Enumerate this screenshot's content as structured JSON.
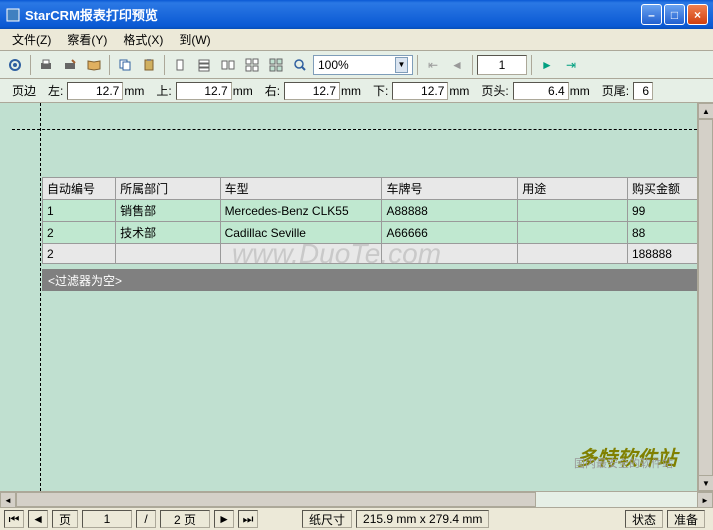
{
  "window": {
    "title": "StarCRM报表打印预览"
  },
  "menu": {
    "file": "文件(Z)",
    "view": "察看(Y)",
    "format": "格式(X)",
    "goto": "到(W)"
  },
  "toolbar": {
    "zoom": "100%",
    "page": "1"
  },
  "margins": {
    "label": "页边",
    "left_lbl": "左:",
    "left": "12.7",
    "left_u": "mm",
    "top_lbl": "上:",
    "top": "12.7",
    "top_u": "mm",
    "right_lbl": "右:",
    "right": "12.7",
    "right_u": "mm",
    "bottom_lbl": "下:",
    "bottom": "12.7",
    "bottom_u": "mm",
    "header_lbl": "页头:",
    "header": "6.4",
    "header_u": "mm",
    "footer_lbl": "页尾:",
    "footer": "6"
  },
  "table": {
    "headers": {
      "id": "自动编号",
      "dept": "所属部门",
      "model": "车型",
      "plate": "车牌号",
      "use": "用途",
      "amt": "购买金额"
    },
    "rows": [
      {
        "id": "1",
        "dept": "销售部",
        "model": "Mercedes-Benz CLK55",
        "plate": "A88888",
        "use": "",
        "amt": "99"
      },
      {
        "id": "2",
        "dept": "技术部",
        "model": "Cadillac Seville",
        "plate": "A66666",
        "use": "",
        "amt": "88"
      }
    ],
    "total": {
      "id": "2",
      "amt": "188888"
    }
  },
  "filter": "<过滤器为空>",
  "watermark": "www.DuoTe.com",
  "brand": "多特软件站",
  "brand_sub": "国内最安全的软件站",
  "status": {
    "page_lbl": "页",
    "page_cur": "1",
    "page_sep": "/",
    "page_total": "2 页",
    "size_lbl": "纸尺寸",
    "size": "215.9 mm x 279.4 mm",
    "state_lbl": "状态",
    "state": "准备"
  }
}
